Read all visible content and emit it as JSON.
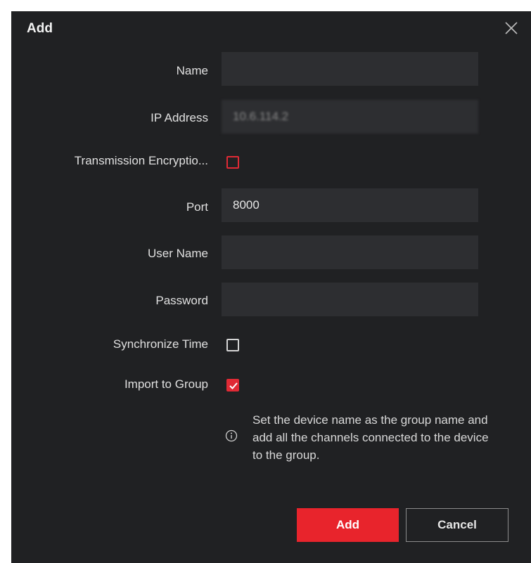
{
  "dialog": {
    "title": "Add"
  },
  "fields": {
    "name": {
      "label": "Name",
      "value": ""
    },
    "ip_address": {
      "label": "IP Address",
      "value": "10.6.114.2"
    },
    "transmission_encryption": {
      "label": "Transmission Encryptio...",
      "checked": false
    },
    "port": {
      "label": "Port",
      "value": "8000"
    },
    "user_name": {
      "label": "User Name",
      "value": ""
    },
    "password": {
      "label": "Password",
      "value": ""
    },
    "synchronize_time": {
      "label": "Synchronize Time",
      "checked": false
    },
    "import_to_group": {
      "label": "Import to Group",
      "checked": true
    }
  },
  "hint": {
    "line1": "Set the device name as the group name and",
    "line2": "add all the channels connected to the device",
    "line3": "to the group."
  },
  "buttons": {
    "add": "Add",
    "cancel": "Cancel"
  },
  "colors": {
    "background": "#202123",
    "field": "#2d2e31",
    "accent": "#e8242c"
  },
  "icons": {
    "close": "close-icon",
    "info": "info-icon",
    "check": "checkmark-icon"
  }
}
